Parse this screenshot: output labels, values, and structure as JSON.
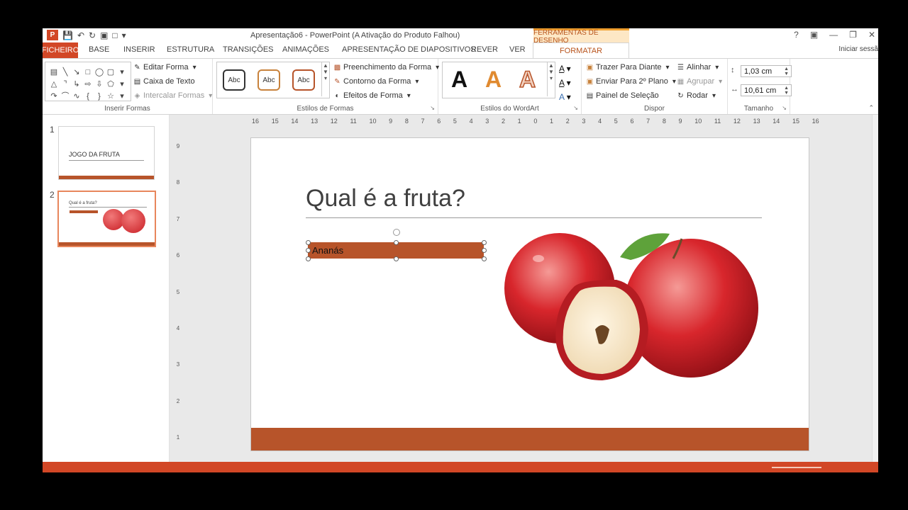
{
  "window": {
    "title": "Apresentação6 - PowerPoint (A Ativação do Produto Falhou)",
    "context_tab": "FERRAMENTAS DE DESENHO",
    "sign_in": "Iniciar sessã"
  },
  "tabs": {
    "file": "FICHEIRO",
    "items": [
      "BASE",
      "INSERIR",
      "ESTRUTURA",
      "TRANSIÇÕES",
      "ANIMAÇÕES",
      "APRESENTAÇÃO DE DIAPOSITIVOS",
      "REVER",
      "VER"
    ],
    "active": "FORMATAR"
  },
  "ribbon": {
    "insert_shapes": {
      "label": "Inserir Formas",
      "edit_shape": "Editar Forma",
      "text_box": "Caixa de Texto",
      "merge_shapes": "Intercalar Formas"
    },
    "shape_styles": {
      "label": "Estilos de Formas",
      "preset": "Abc",
      "fill": "Preenchimento da Forma",
      "outline": "Contorno da Forma",
      "effects": "Efeitos de Forma"
    },
    "wordart": {
      "label": "Estilos do WordArt",
      "letter": "A"
    },
    "arrange": {
      "label": "Dispor",
      "bring_forward": "Trazer Para Diante",
      "send_backward": "Enviar Para 2º Plano",
      "selection_pane": "Painel de Seleção",
      "align": "Alinhar",
      "group": "Agrupar",
      "rotate": "Rodar"
    },
    "size": {
      "label": "Tamanho",
      "height": "1,03 cm",
      "width": "10,61 cm"
    }
  },
  "ruler": {
    "horizontal": [
      "16",
      "15",
      "14",
      "13",
      "12",
      "11",
      "10",
      "9",
      "8",
      "7",
      "6",
      "5",
      "4",
      "3",
      "2",
      "1",
      "0",
      "1",
      "2",
      "3",
      "4",
      "5",
      "6",
      "7",
      "8",
      "9",
      "10",
      "11",
      "12",
      "13",
      "14",
      "15",
      "16"
    ],
    "vertical": [
      "9",
      "8",
      "7",
      "6",
      "5",
      "4",
      "3",
      "2",
      "1"
    ]
  },
  "thumbnails": [
    {
      "number": "1",
      "title": "JOGO DA FRUTA"
    },
    {
      "number": "2",
      "title": "Qual é a fruta?"
    }
  ],
  "slide": {
    "title": "Qual é a fruta?",
    "shape_text": "Ananás"
  },
  "colors": {
    "accent": "#d24726",
    "theme_band": "#b7542a"
  }
}
